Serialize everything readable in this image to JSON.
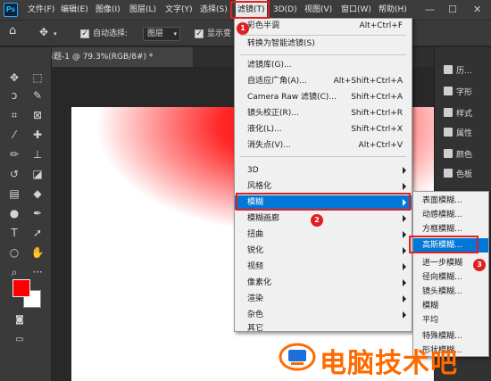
{
  "app": {
    "logo": "Ps"
  },
  "menubar": {
    "items": [
      "文件(F)",
      "编辑(E)",
      "图像(I)",
      "图层(L)",
      "文字(Y)",
      "选择(S)",
      "滤镜(T)",
      "3D(D)",
      "视图(V)",
      "窗口(W)",
      "帮助(H)"
    ],
    "window_controls": [
      "minimize",
      "maximize",
      "close"
    ]
  },
  "options": {
    "auto_select_label": "自动选择:",
    "layer_dropdown": "图层",
    "show_transform_label": "显示变"
  },
  "document": {
    "tab_title": "未标题-1 @ 79.3%(RGB/8#) *"
  },
  "tools": [
    "move-icon",
    "marquee-icon",
    "lasso-icon",
    "crop-icon",
    "eyedropper-icon",
    "healing-icon",
    "brush-icon",
    "stamp-icon",
    "history-brush-icon",
    "eraser-icon",
    "gradient-icon",
    "blur-icon",
    "dodge-icon",
    "pen-icon",
    "type-icon",
    "path-select-icon",
    "shape-icon",
    "hand-icon",
    "zoom-icon",
    "more-icon"
  ],
  "colors": {
    "foreground": "#ff0000",
    "background": "#ffffff",
    "highlight": "#0078d7",
    "annotation": "#e02020",
    "watermark": "#ff6a00"
  },
  "panels": [
    "历...",
    "字形",
    "样式",
    "属性",
    "颜色",
    "色板"
  ],
  "filter_menu": {
    "items": [
      {
        "label": "彩色半调",
        "shortcut": "Alt+Ctrl+F"
      },
      {
        "label": "转换为智能滤镜(S)",
        "shortcut": ""
      },
      {
        "label": "滤镜库(G)...",
        "shortcut": ""
      },
      {
        "label": "自适应广角(A)...",
        "shortcut": "Alt+Shift+Ctrl+A"
      },
      {
        "label": "Camera Raw 滤镜(C)...",
        "shortcut": "Shift+Ctrl+A"
      },
      {
        "label": "镜头校正(R)...",
        "shortcut": "Shift+Ctrl+R"
      },
      {
        "label": "液化(L)...",
        "shortcut": "Shift+Ctrl+X"
      },
      {
        "label": "消失点(V)...",
        "shortcut": "Alt+Ctrl+V"
      },
      {
        "label": "3D",
        "submenu": true
      },
      {
        "label": "风格化",
        "submenu": true
      },
      {
        "label": "模糊",
        "submenu": true,
        "highlighted": true
      },
      {
        "label": "模糊画廊",
        "submenu": true
      },
      {
        "label": "扭曲",
        "submenu": true
      },
      {
        "label": "锐化",
        "submenu": true
      },
      {
        "label": "视频",
        "submenu": true
      },
      {
        "label": "像素化",
        "submenu": true
      },
      {
        "label": "渲染",
        "submenu": true
      },
      {
        "label": "杂色",
        "submenu": true
      },
      {
        "label": "其它",
        "submenu": true
      }
    ]
  },
  "blur_submenu": {
    "items": [
      "表面模糊...",
      "动感模糊...",
      "方框模糊...",
      "高斯模糊...",
      "进一步模糊",
      "径向模糊...",
      "镜头模糊...",
      "模糊",
      "平均",
      "特殊模糊...",
      "形状模糊..."
    ],
    "highlighted_index": 3
  },
  "annotations": {
    "step1": "1",
    "step2": "2",
    "step3": "3"
  },
  "watermark": {
    "text": "电脑技术吧"
  }
}
